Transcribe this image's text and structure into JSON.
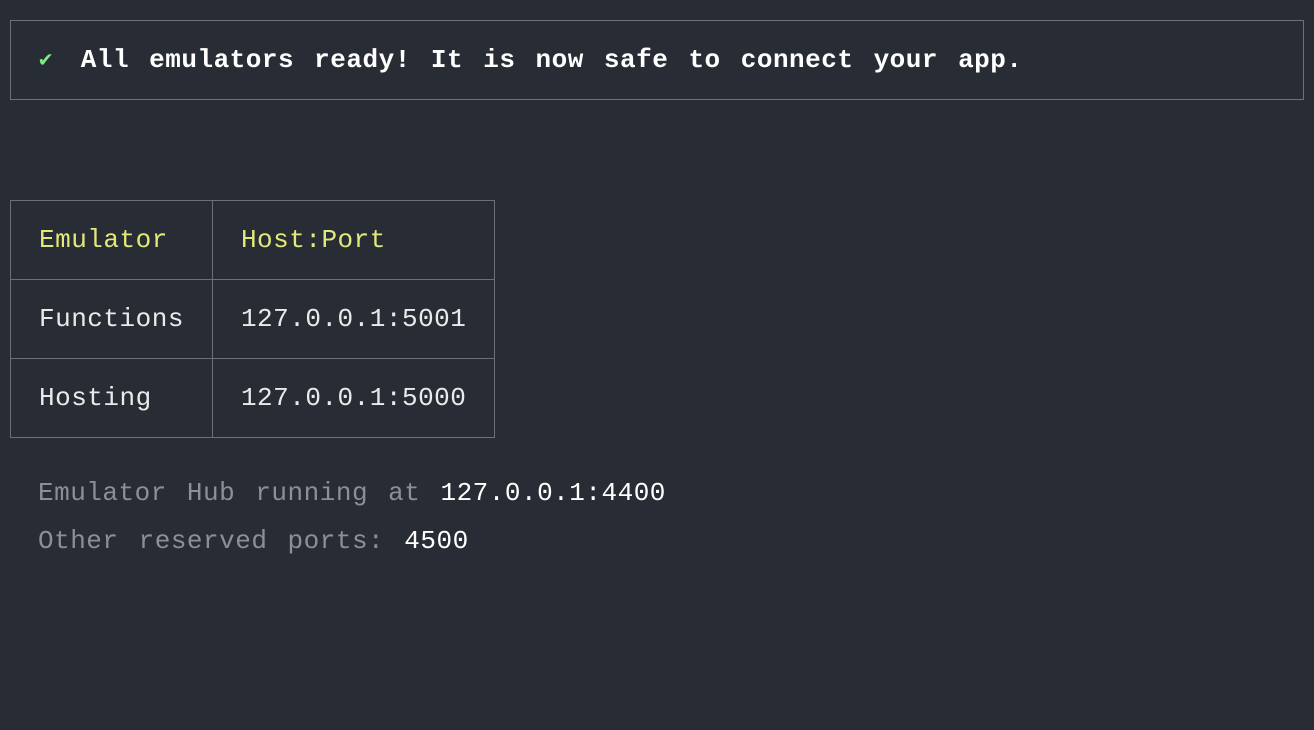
{
  "banner": {
    "check_symbol": "✔",
    "message": "All emulators ready! It is now safe to connect your app."
  },
  "table": {
    "headers": {
      "emulator": "Emulator",
      "host_port": "Host:Port"
    },
    "rows": [
      {
        "name": "Functions",
        "host_port": "127.0.0.1:5001"
      },
      {
        "name": "Hosting",
        "host_port": "127.0.0.1:5000"
      }
    ]
  },
  "hub": {
    "label": "Emulator Hub running at ",
    "address": "127.0.0.1:4400"
  },
  "reserved": {
    "label": "Other reserved ports: ",
    "ports": "4500"
  }
}
